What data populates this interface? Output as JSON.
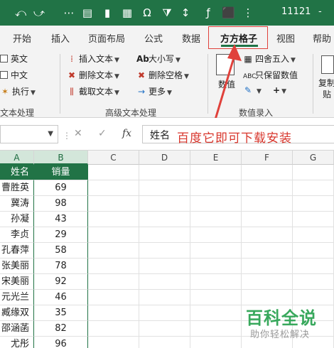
{
  "titlebar": {
    "title": "11121",
    "dash": "-",
    "icons": [
      "undo-icon",
      "redo-icon",
      "form-icon",
      "chart-icon",
      "table-icon",
      "symbol-icon",
      "filter-icon",
      "sort-icon",
      "function-icon",
      "tag-icon"
    ]
  },
  "tabs": [
    "开始",
    "插入",
    "页面布局",
    "公式",
    "数据",
    "方方格子",
    "视图",
    "帮助"
  ],
  "active_tab": "方方格子",
  "ribbon": {
    "left_group": {
      "check_en": "英文",
      "check_zh": "中文",
      "execute": "执行",
      "label": "文本处理"
    },
    "advanced_group": {
      "insert_text": "插入文本",
      "delete_text": "删除文本",
      "extract_text": "截取文本",
      "case": "大小写",
      "delete_space": "删除空格",
      "more": "更多",
      "label": "高级文本处理"
    },
    "number_group": {
      "numeric": "数值",
      "round": "四舍五入",
      "keep_value": "只保留数值",
      "label": "数值录入",
      "copy": "复制",
      "paste": "贴",
      "plus": "+"
    }
  },
  "formula_bar": {
    "name_box": "",
    "cancel": "✕",
    "enter": "✓",
    "fx": "fx",
    "value": "姓名",
    "overlay_text": "百度它即可下载安装"
  },
  "columns": [
    "A",
    "B",
    "C",
    "D",
    "E",
    "F",
    "G"
  ],
  "rows": [
    {
      "a": "姓名",
      "b": "销量"
    },
    {
      "a": "曹胜英",
      "b": "69"
    },
    {
      "a": "冀涛",
      "b": "98"
    },
    {
      "a": "孙凝",
      "b": "43"
    },
    {
      "a": "李贞",
      "b": "29"
    },
    {
      "a": "孔春萍",
      "b": "58"
    },
    {
      "a": "张美丽",
      "b": "78"
    },
    {
      "a": "宋美丽",
      "b": "92"
    },
    {
      "a": "元光兰",
      "b": "46"
    },
    {
      "a": "臧缘双",
      "b": "35"
    },
    {
      "a": "邵涵菡",
      "b": "82"
    },
    {
      "a": "尤彤",
      "b": "96"
    }
  ],
  "logo": {
    "main": "百科全说",
    "sub": "助你轻松解决"
  },
  "colors": {
    "excel_green": "#217346",
    "annotation_red": "#e0413b",
    "logo_green": "#38a85c"
  }
}
